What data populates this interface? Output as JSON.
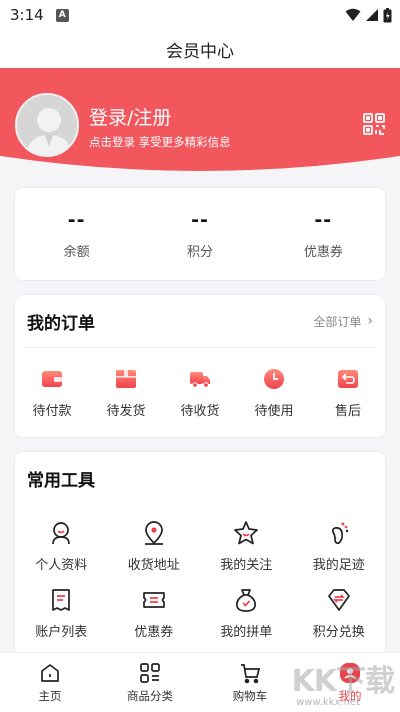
{
  "status": {
    "time": "3:14",
    "notif": "A"
  },
  "header": {
    "title": "会员中心"
  },
  "profile": {
    "login_title": "登录/注册",
    "login_sub": "点击登录 享受更多精彩信息"
  },
  "stats": [
    {
      "value": "--",
      "label": "余额"
    },
    {
      "value": "--",
      "label": "积分"
    },
    {
      "value": "--",
      "label": "优惠券"
    }
  ],
  "orders": {
    "title": "我的订单",
    "more": "全部订单",
    "items": [
      {
        "label": "待付款",
        "icon": "wallet-icon"
      },
      {
        "label": "待发货",
        "icon": "package-icon"
      },
      {
        "label": "待收货",
        "icon": "truck-icon"
      },
      {
        "label": "待使用",
        "icon": "clock-icon"
      },
      {
        "label": "售后",
        "icon": "return-icon"
      }
    ]
  },
  "tools": {
    "title": "常用工具",
    "items": [
      {
        "label": "个人资料",
        "icon": "person-icon"
      },
      {
        "label": "收货地址",
        "icon": "location-icon"
      },
      {
        "label": "我的关注",
        "icon": "star-icon"
      },
      {
        "label": "我的足迹",
        "icon": "footprint-icon"
      },
      {
        "label": "账户列表",
        "icon": "list-icon"
      },
      {
        "label": "优惠券",
        "icon": "coupon-icon"
      },
      {
        "label": "我的拼单",
        "icon": "group-bag-icon"
      },
      {
        "label": "积分兑换",
        "icon": "exchange-icon"
      }
    ]
  },
  "tabbar": [
    {
      "label": "主页",
      "icon": "home-icon"
    },
    {
      "label": "商品分类",
      "icon": "category-icon"
    },
    {
      "label": "购物车",
      "icon": "cart-icon"
    },
    {
      "label": "我的",
      "icon": "user-tab-icon",
      "active": true
    }
  ],
  "watermark": {
    "brand": "KK下载",
    "url": "www.kkx.net"
  },
  "colors": {
    "accent": "#f0525a",
    "header_bg": "#f2575e"
  }
}
